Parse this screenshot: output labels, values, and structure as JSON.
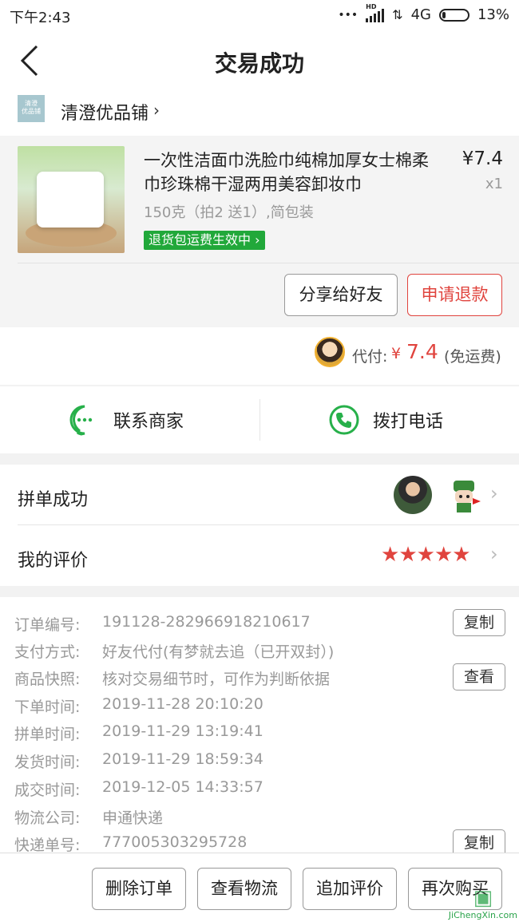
{
  "status_bar": {
    "time": "下午2:43",
    "dots": "•••",
    "hd": "HD",
    "network": "4G",
    "battery": "13%"
  },
  "header": {
    "title": "交易成功"
  },
  "shop": {
    "logo_text": "清澄\n优品铺",
    "name": "清澄优品铺"
  },
  "product": {
    "title": "一次性洁面巾洗脸巾纯棉加厚女士棉柔巾珍珠棉干湿两用美容卸妆巾",
    "price": "¥7.4",
    "quantity": "x1",
    "spec": "150克（拍2 送1）,简包装",
    "tag": "退货包运费生效中",
    "buttons": {
      "share": "分享给好友",
      "refund": "申请退款"
    }
  },
  "payment": {
    "label": "代付:",
    "currency": "¥",
    "amount": "7.4",
    "note": "(免运费)"
  },
  "contact": {
    "merchant": "联系商家",
    "call": "拨打电话"
  },
  "group": {
    "label": "拼单成功"
  },
  "review": {
    "label": "我的评价",
    "rating": 5
  },
  "order_info": {
    "rows": [
      {
        "label": "订单编号:",
        "value": "191128-282966918210617",
        "action": "复制"
      },
      {
        "label": "支付方式:",
        "value": "好友代付(有梦就去追（已开双封）)",
        "action": ""
      },
      {
        "label": "商品快照:",
        "value": "核对交易细节时，可作为判断依据",
        "action": "查看"
      },
      {
        "label": "下单时间:",
        "value": "2019-11-28 20:10:20",
        "action": ""
      },
      {
        "label": "拼单时间:",
        "value": "2019-11-29 13:19:41",
        "action": ""
      },
      {
        "label": "发货时间:",
        "value": "2019-11-29 18:59:34",
        "action": ""
      },
      {
        "label": "成交时间:",
        "value": "2019-12-05 14:33:57",
        "action": ""
      },
      {
        "label": "物流公司:",
        "value": "申通快递",
        "action": ""
      },
      {
        "label": "快递单号:",
        "value": "777005303295728",
        "action": "复制"
      }
    ]
  },
  "bottom_bar": {
    "delete": "删除订单",
    "logistics": "查看物流",
    "add_review": "追加评价",
    "buy_again": "再次购买"
  },
  "watermark": {
    "text": "JiChengXin.com"
  },
  "colors": {
    "accent_red": "#e0443e",
    "green": "#27b04a",
    "tag_green": "#21a83a"
  }
}
